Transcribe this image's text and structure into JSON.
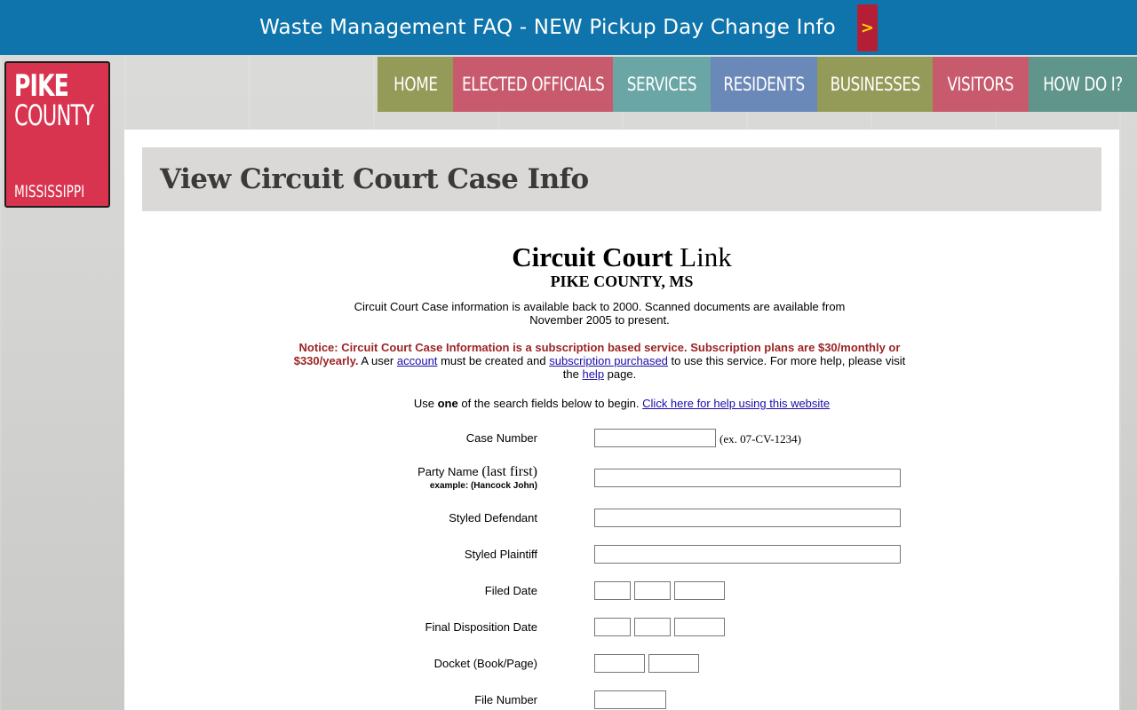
{
  "banner": {
    "text": "Waste Management FAQ - NEW Pickup Day Change Info",
    "arrow": ">"
  },
  "logo": {
    "line1": "PIKE",
    "line2": "COUNTY",
    "line3": "MISSISSIPPI"
  },
  "nav": [
    {
      "label": "HOME",
      "color": "#949a57"
    },
    {
      "label": "ELECTED OFFICIALS",
      "color": "#c85a6d"
    },
    {
      "label": "SERVICES",
      "color": "#6aa6a6"
    },
    {
      "label": "RESIDENTS",
      "color": "#6a88b8"
    },
    {
      "label": "BUSINESSES",
      "color": "#949a57"
    },
    {
      "label": "VISITORS",
      "color": "#c85a6d"
    },
    {
      "label": "HOW DO I?",
      "color": "#5f958a"
    }
  ],
  "page": {
    "title": "View Circuit Court Case Info"
  },
  "court": {
    "heading_bold": "Circuit Court",
    "heading_rest": "Link",
    "county": "PIKE COUNTY, MS",
    "availability": "Circuit Court Case information is available back to 2000. Scanned documents are available from November 2005 to present.",
    "notice": "Notice: Circuit Court Case Information is a subscription based service. Subscription plans are $30/monthly or $330/yearly.",
    "notice_t1": "A user",
    "link_account": "account",
    "notice_t2": "must be created and",
    "link_subscription": "subscription purchased",
    "notice_t3": "to use this service. For more help, please visit the",
    "link_help": "help",
    "notice_t4": "page.",
    "use_t1": "Use",
    "use_one": "one",
    "use_t2": "of the search fields below to begin.",
    "link_help_site": "Click here for help using this website"
  },
  "form": {
    "case_number_label": "Case Number",
    "case_number_hint": "(ex. 07-CV-1234)",
    "party_name_label": "Party Name",
    "party_name_label_paren": "(last first)",
    "party_name_example": "example: (Hancock John)",
    "styled_defendant_label": "Styled Defendant",
    "styled_plaintiff_label": "Styled Plaintiff",
    "filed_date_label": "Filed Date",
    "final_disposition_label": "Final Disposition Date",
    "docket_label": "Docket (Book/Page)",
    "file_number_label": "File Number"
  }
}
